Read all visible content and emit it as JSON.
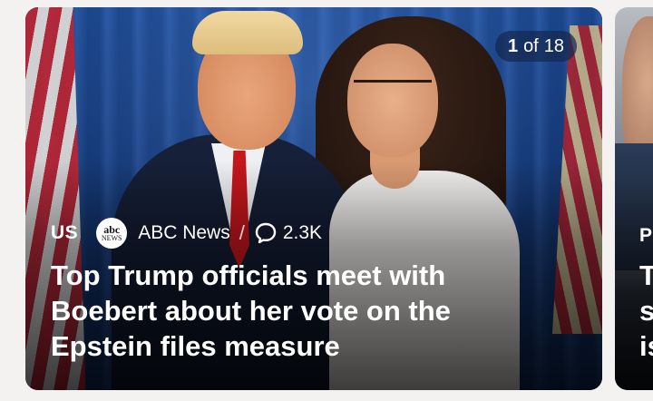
{
  "main_card": {
    "slide_counter": {
      "current": "1",
      "separator": "of",
      "total": "18"
    },
    "category": "US",
    "source": {
      "logo_text_top": "abc",
      "logo_text_bottom": "NEWS",
      "name": "ABC News"
    },
    "separator": "/",
    "comments": {
      "icon": "speech-bubble-icon",
      "count": "2.3K"
    },
    "headline": "Top Trump officials meet with Boebert about her vote on the Epstein files measure"
  },
  "next_card": {
    "category": "P",
    "headline": "T s is"
  },
  "colors": {
    "page_background": "#f3f2f0",
    "counter_pill": "#142850",
    "text": "#ffffff"
  }
}
